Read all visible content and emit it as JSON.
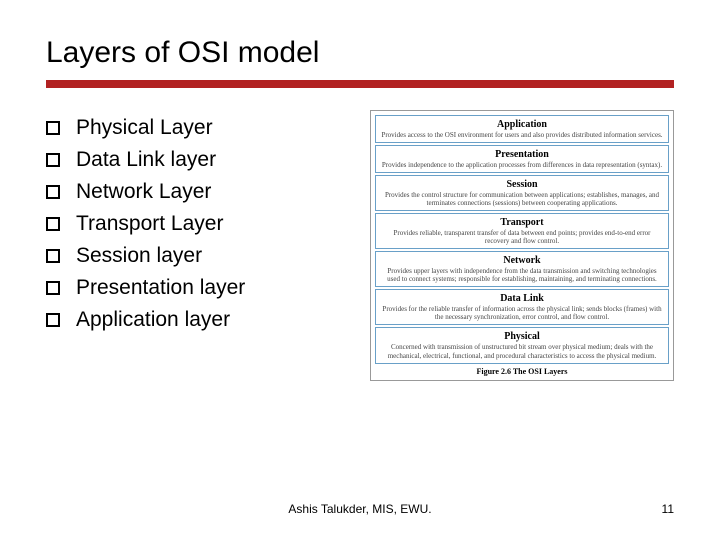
{
  "title": "Layers of OSI model",
  "bullets": [
    "Physical Layer",
    "Data Link layer",
    "Network Layer",
    "Transport Layer",
    "Session layer",
    "Presentation layer",
    "Application layer"
  ],
  "diagram": {
    "rows": [
      {
        "title": "Application",
        "desc": "Provides access to the OSI environment for users and also provides distributed information services."
      },
      {
        "title": "Presentation",
        "desc": "Provides independence to the application processes from differences in data representation (syntax)."
      },
      {
        "title": "Session",
        "desc": "Provides the control structure for communication between applications; establishes, manages, and terminates connections (sessions) between cooperating applications."
      },
      {
        "title": "Transport",
        "desc": "Provides reliable, transparent transfer of data between end points; provides end-to-end error recovery and flow control."
      },
      {
        "title": "Network",
        "desc": "Provides upper layers with independence from the data transmission and switching technologies used to connect systems; responsible for establishing, maintaining, and terminating connections."
      },
      {
        "title": "Data Link",
        "desc": "Provides for the reliable transfer of information across the physical link; sends blocks (frames) with the necessary synchronization, error control, and flow control."
      },
      {
        "title": "Physical",
        "desc": "Concerned with transmission of unstructured bit stream over physical medium; deals with the mechanical, electrical, functional, and procedural characteristics to access the physical medium."
      }
    ],
    "caption": "Figure 2.6 The OSI Layers"
  },
  "footer": {
    "center": "Ashis Talukder, MIS, EWU.",
    "page": "11"
  }
}
